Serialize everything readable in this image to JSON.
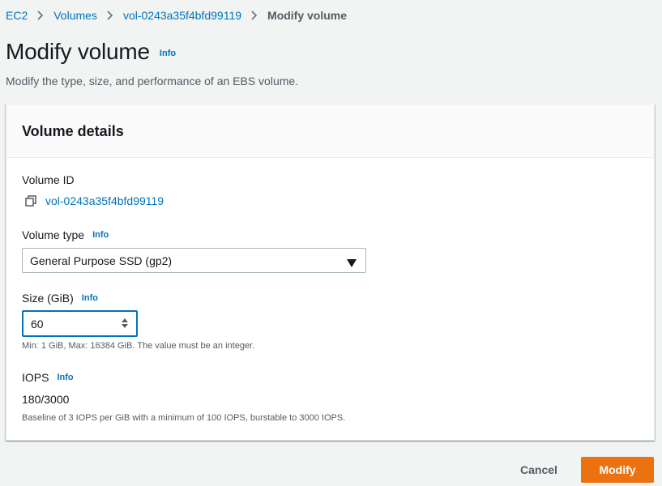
{
  "breadcrumb": {
    "items": [
      "EC2",
      "Volumes",
      "vol-0243a35f4bfd99119"
    ],
    "current": "Modify volume"
  },
  "header": {
    "title": "Modify volume",
    "info": "Info",
    "description": "Modify the type, size, and performance of an EBS volume."
  },
  "panel": {
    "title": "Volume details",
    "volume_id": {
      "label": "Volume ID",
      "value": "vol-0243a35f4bfd99119",
      "icon": "copy-icon"
    },
    "volume_type": {
      "label": "Volume type",
      "info": "Info",
      "selected": "General Purpose SSD (gp2)"
    },
    "size": {
      "label": "Size (GiB)",
      "info": "Info",
      "value": "60",
      "hint": "Min: 1 GiB, Max: 16384 GiB. The value must be an integer."
    },
    "iops": {
      "label": "IOPS",
      "info": "Info",
      "value": "180/3000",
      "hint": "Baseline of 3 IOPS per GiB with a minimum of 100 IOPS, burstable to 3000 IOPS."
    }
  },
  "footer": {
    "cancel_label": "Cancel",
    "modify_label": "Modify"
  },
  "colors": {
    "link": "#0073bb",
    "primary_button": "#ec7211",
    "background": "#f2f3f3"
  }
}
